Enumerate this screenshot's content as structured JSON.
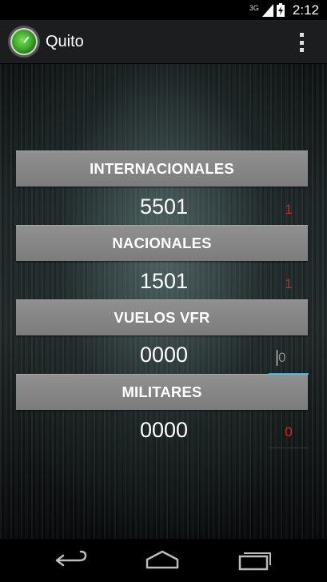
{
  "status_bar": {
    "network": "3G",
    "time": "2:12"
  },
  "action_bar": {
    "title": "Quito",
    "app_icon": "radar-icon",
    "menu_icon": "overflow-menu-icon"
  },
  "sections": [
    {
      "header": "INTERNACIONALES",
      "value": "5501",
      "side_value": "1"
    },
    {
      "header": "NACIONALES",
      "value": "1501",
      "side_value": "1"
    },
    {
      "header": "VUELOS VFR",
      "value": "0000",
      "side_value": "0"
    },
    {
      "header": "MILITARES",
      "value": "0000",
      "side_value": "0"
    }
  ],
  "colors": {
    "accent": "#33b5e5",
    "red_value": "#e02020",
    "header_bg": "#858585"
  },
  "nav_bar": {
    "back_icon": "back-icon",
    "home_icon": "home-icon",
    "recent_icon": "recent-apps-icon"
  }
}
